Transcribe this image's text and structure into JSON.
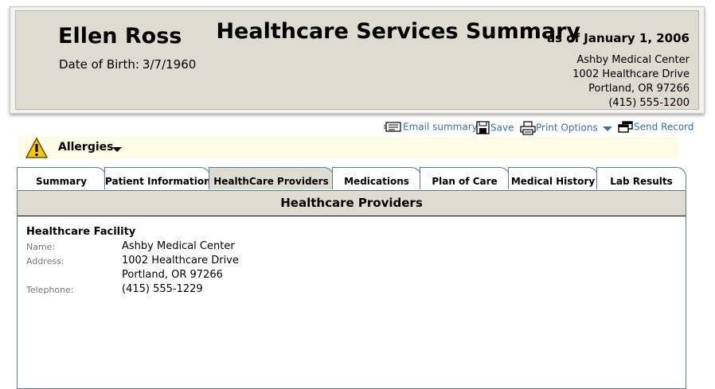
{
  "header": {
    "patient_name": "Ellen Ross",
    "dob_label": "Date of Birth:",
    "dob_value": "3/7/1960",
    "title": "Healthcare Services Summary",
    "as_of": "as of January 1, 2006",
    "facility_name": "Ashby Medical Center",
    "facility_address1": "1002 Healthcare Drive",
    "facility_address2": "Portland, OR  97266",
    "facility_phone": "(415) 555-1200"
  },
  "toolbar": {
    "email": "Email summary",
    "save": "Save",
    "print": "Print Options",
    "send": "Send Record",
    "link_color": "#3a6fb5"
  },
  "allergies": {
    "label": "Allergies",
    "bar_color": "#fcfce4"
  },
  "tabs": [
    {
      "label": "Summary"
    },
    {
      "label": "Patient Information"
    },
    {
      "label": "HealthCare Providers",
      "active": true
    },
    {
      "label": "Medications"
    },
    {
      "label": "Plan of Care"
    },
    {
      "label": "Medical History"
    },
    {
      "label": "Lab Results"
    }
  ],
  "panel": {
    "title": "Healthcare Providers",
    "section_title": "Healthcare Facility",
    "fields": {
      "name_label": "Name:",
      "name_value": "Ashby Medical Center",
      "address_label": "Address:",
      "address_line1": "1002 Healthcare Drive",
      "address_line2": "Portland, OR  97266",
      "telephone_label": "Telephone:",
      "telephone_value": "(415) 555-1229"
    }
  }
}
